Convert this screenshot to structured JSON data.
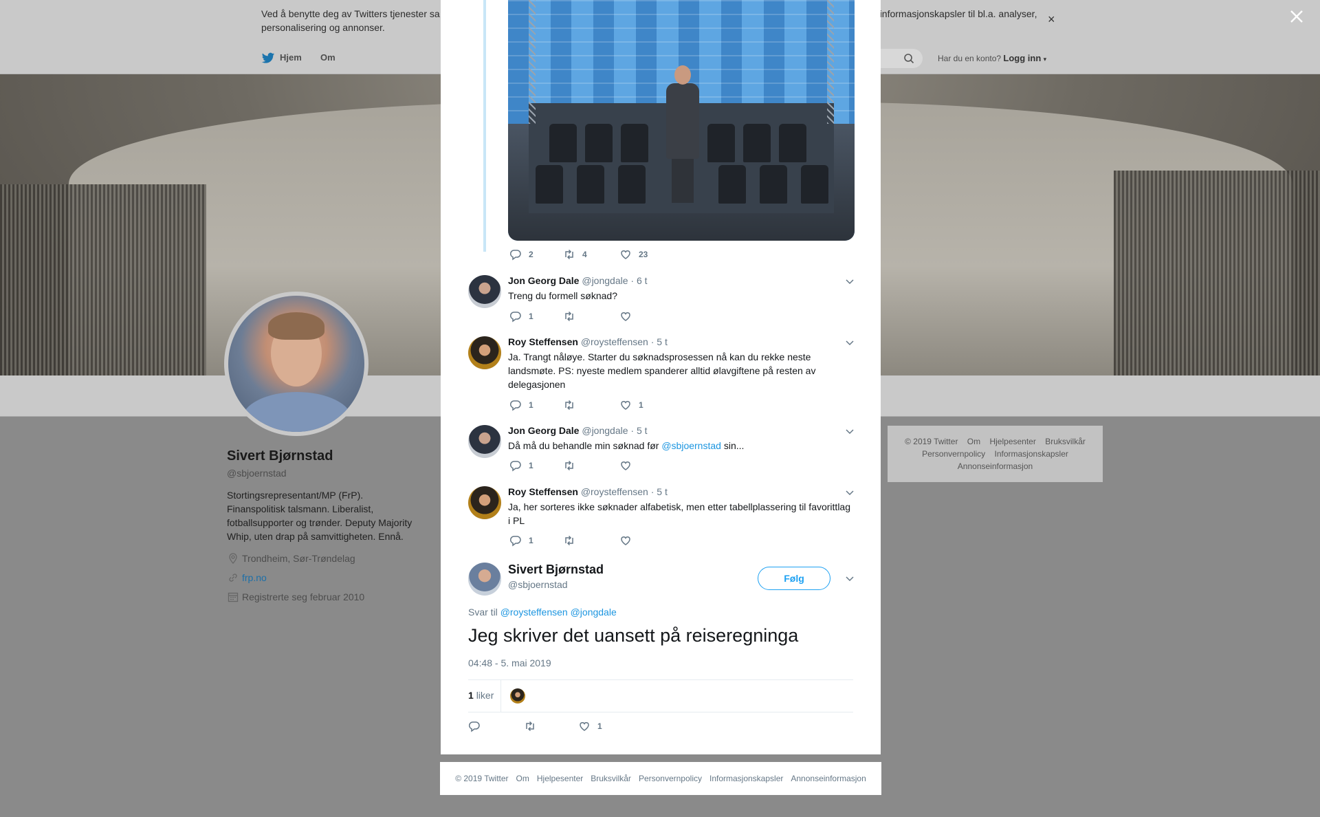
{
  "cookie_bar": {
    "text": "Ved å benytte deg av Twitters tjenester sa",
    "text_right": "informasjonskapsler til bl.a. analyser,",
    "text_line2": "personalisering og annonser.",
    "close": "×"
  },
  "nav": {
    "home": "Hjem",
    "about": "Om",
    "have_account": "Har du en konto?",
    "login": "Logg inn"
  },
  "profile": {
    "name": "Sivert Bjørnstad",
    "handle": "@sbjoernstad",
    "bio": "Stortingsrepresentant/MP (FrP). Finanspolitisk talsmann. Liberalist, fotballsupporter og trønder. Deputy Majority Whip, uten drap på samvittigheten. Ennå.",
    "location": "Trondheim, Sør-Trøndelag",
    "website": "frp.no",
    "joined": "Registrerte seg februar 2010"
  },
  "side_footer": {
    "items": [
      "© 2019 Twitter",
      "Om",
      "Hjelpesenter",
      "Bruksvilkår",
      "Personvernpolicy",
      "Informasjonskapsler",
      "Annonseinformasjon"
    ]
  },
  "thread": {
    "photo_tweet_stats": {
      "replies": "2",
      "retweets": "4",
      "likes": "23"
    },
    "replies": [
      {
        "name": "Jon Georg Dale",
        "handle": "@jongdale",
        "time": "· 6 t",
        "text": "Treng du formell søknad?",
        "stats": {
          "replies": "1",
          "retweets": "",
          "likes": ""
        }
      },
      {
        "name": "Roy Steffensen",
        "handle": "@roysteffensen",
        "time": "· 5 t",
        "text": "Ja. Trangt nåløye. Starter du søknadsprosessen nå kan du rekke neste landsmøte. PS: nyeste medlem spanderer alltid ølavgiftene på resten av delegasjonen",
        "stats": {
          "replies": "1",
          "retweets": "",
          "likes": "1"
        }
      },
      {
        "name": "Jon Georg Dale",
        "handle": "@jongdale",
        "time": "· 5 t",
        "text_before": "Då må du behandle min søknad før ",
        "mention": "@sbjoernstad",
        "text_after": " sin...",
        "stats": {
          "replies": "1",
          "retweets": "",
          "likes": ""
        }
      },
      {
        "name": "Roy Steffensen",
        "handle": "@roysteffensen",
        "time": "· 5 t",
        "text": "Ja, her sorteres ikke søknader alfabetisk, men etter tabellplassering til favorittlag i PL",
        "stats": {
          "replies": "1",
          "retweets": "",
          "likes": ""
        }
      }
    ]
  },
  "main_tweet": {
    "name": "Sivert Bjørnstad",
    "handle": "@sbjoernstad",
    "follow": "Følg",
    "reply_to_label": "Svar til",
    "reply_to_1": "@roysteffensen",
    "reply_to_2": "@jongdale",
    "text": "Jeg skriver det uansett på reiseregninga",
    "timestamp": "04:48 - 5. mai 2019",
    "like_count": "1",
    "like_label": "liker",
    "stats": {
      "replies": "",
      "retweets": "",
      "likes": "1"
    }
  },
  "modal_footer": {
    "items": [
      "© 2019 Twitter",
      "Om",
      "Hjelpesenter",
      "Bruksvilkår",
      "Personvernpolicy",
      "Informasjonskapsler",
      "Annonseinformasjon"
    ]
  },
  "colors": {
    "accent": "#1da1f2",
    "link": "#1b95e0",
    "muted": "#657786",
    "thread_line": "#c8e6f7",
    "overlay_dim": "#8a8a8a"
  }
}
